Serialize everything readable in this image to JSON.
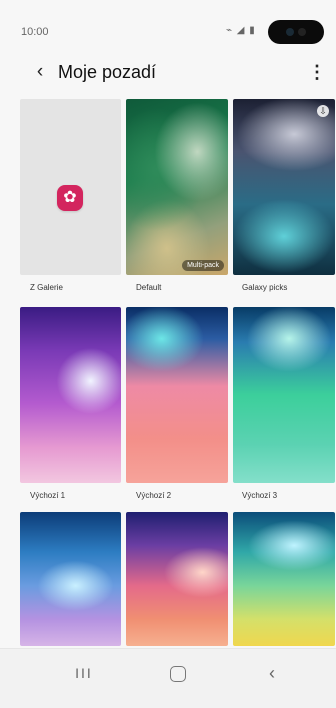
{
  "status": {
    "time": "10:00",
    "icons_text": "⌁ ◢ ▮"
  },
  "header": {
    "title": "Moje pozadí",
    "back_icon": "back-icon",
    "more_icon": "more-vert-icon"
  },
  "grid": {
    "tiles": [
      {
        "label": "Z Galerie"
      },
      {
        "label": "Default",
        "badge": "Multi-pack"
      },
      {
        "label": "Galaxy picks"
      },
      {
        "label": "Výchozí 1"
      },
      {
        "label": "Výchozí 2"
      },
      {
        "label": "Výchozí 3"
      },
      {
        "label": ""
      },
      {
        "label": ""
      },
      {
        "label": ""
      }
    ]
  },
  "nav": {
    "recents_label": "III",
    "back_label": "‹"
  },
  "colors": {
    "gallery_icon": "#d3255e",
    "background": "#f7f7f7"
  }
}
